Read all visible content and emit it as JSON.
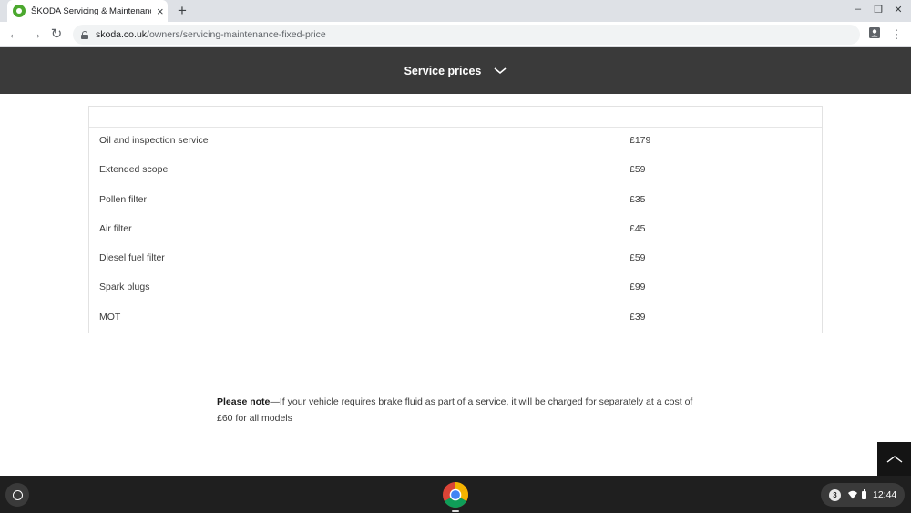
{
  "browser": {
    "tab_title": "ŠKODA Servicing & Maintenance",
    "url_host": "skoda.co.uk",
    "url_path": "/owners/servicing-maintenance-fixed-price"
  },
  "header": {
    "title": "Service prices",
    "dropdown_icon": "chevron-down-icon"
  },
  "price_table": {
    "rows": [
      {
        "item": "Oil and inspection service",
        "price": "£179"
      },
      {
        "item": "Extended scope",
        "price": "£59"
      },
      {
        "item": "Pollen filter",
        "price": "£35"
      },
      {
        "item": "Air filter",
        "price": "£45"
      },
      {
        "item": "Diesel fuel filter",
        "price": "£59"
      },
      {
        "item": "Spark plugs",
        "price": "£99"
      },
      {
        "item": "MOT",
        "price": "£39"
      }
    ]
  },
  "note": {
    "label": "Please note",
    "text": "—If your vehicle requires brake fluid as part of a service, it will be charged for separately at a cost of £60 for all models"
  },
  "shelf": {
    "notification_count": "3",
    "time": "12:44"
  },
  "colors": {
    "header_bg": "#3a3a3a",
    "brand_green": "#4ba82e",
    "shelf_bg": "#1f1f1f"
  }
}
